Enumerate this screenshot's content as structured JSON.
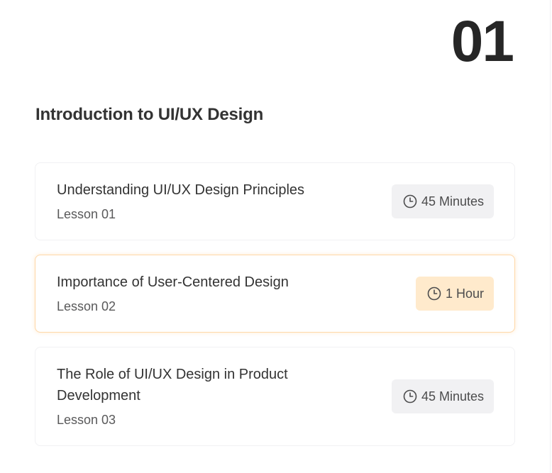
{
  "module": {
    "number": "01",
    "title": "Introduction to UI/UX Design"
  },
  "lessons": [
    {
      "title": "Understanding UI/UX Design Principles",
      "subtitle": "Lesson 01",
      "duration": "45 Minutes",
      "icon": "clock-icon",
      "active": false
    },
    {
      "title": "Importance of User-Centered Design",
      "subtitle": "Lesson 02",
      "duration": "1 Hour",
      "icon": "clock-icon",
      "active": true
    },
    {
      "title": "The Role of UI/UX Design in Product Development",
      "subtitle": "Lesson 03",
      "duration": "45 Minutes",
      "icon": "clock-icon",
      "active": false
    }
  ],
  "colors": {
    "active_border": "#ffd8a8",
    "active_badge": "#ffeacc",
    "badge": "#f1f1f3",
    "text": "#333333"
  }
}
